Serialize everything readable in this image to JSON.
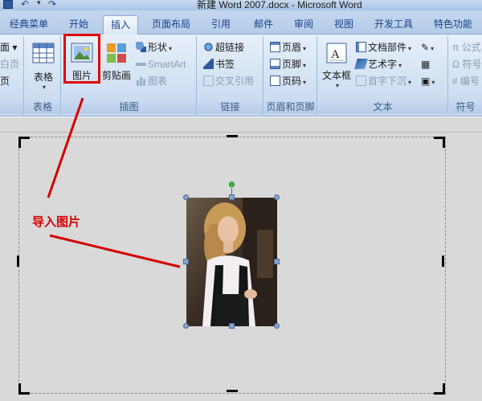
{
  "window": {
    "title": "新建 Word 2007.docx - Microsoft Word"
  },
  "tabs": [
    {
      "label": "经典菜单"
    },
    {
      "label": "开始"
    },
    {
      "label": "插入",
      "active": true
    },
    {
      "label": "页面布局"
    },
    {
      "label": "引用"
    },
    {
      "label": "邮件"
    },
    {
      "label": "审阅"
    },
    {
      "label": "视图"
    },
    {
      "label": "开发工具"
    },
    {
      "label": "特色功能"
    }
  ],
  "ribbon": {
    "partial_left": {
      "items": [
        "面 ▾",
        "白页",
        "页"
      ]
    },
    "table_group": {
      "label": "表格",
      "button": "表格"
    },
    "illustration_group": {
      "label": "插图",
      "picture": "图片",
      "clipart": "剪贴画",
      "shapes": "形状",
      "smartart": "SmartArt",
      "chart": "图表"
    },
    "links_group": {
      "label": "链接",
      "hyperlink": "超链接",
      "bookmark": "书签",
      "crossref": "交叉引用"
    },
    "header_footer_group": {
      "label": "页眉和页脚",
      "header": "页眉",
      "footer": "页脚",
      "page_number": "页码"
    },
    "text_group": {
      "label": "文本",
      "textbox": "文本框",
      "quickparts": "文档部件",
      "wordart": "艺术字",
      "dropcap": "首字下沉"
    },
    "symbols_group": {
      "label": "符号",
      "equation": "公式",
      "symbol": "符号",
      "number": "编号"
    }
  },
  "annotation": {
    "text": "导入图片",
    "color": "#d40000"
  },
  "colors": {
    "accent": "#15428b",
    "highlight": "#e10000",
    "ribbon_bg": "#cfdff2"
  }
}
